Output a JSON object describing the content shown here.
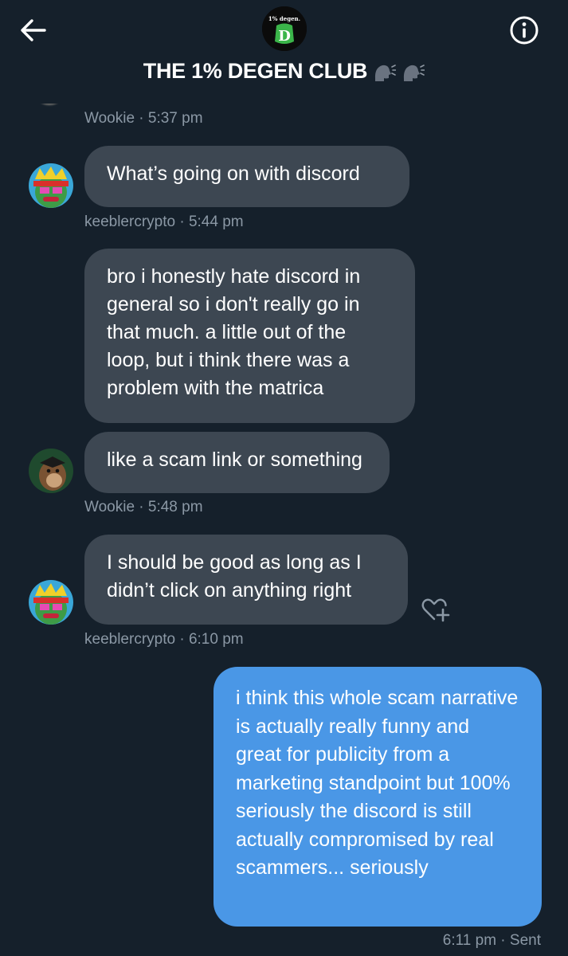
{
  "header": {
    "title": "THE 1% DEGEN CLUB",
    "title_emoji_icon": "speaking-head-icon",
    "back_icon": "arrow-left-icon",
    "info_icon": "info-circle-icon",
    "group_avatar": {
      "line1": "1% degen.",
      "letter": "D"
    }
  },
  "messages": [
    {
      "id": "m0",
      "meta": "Wookie · 5:37 pm"
    },
    {
      "id": "m1",
      "text": "What’s going on with discord",
      "meta": "keeblercrypto · 5:44 pm"
    },
    {
      "id": "m2",
      "text": "bro i honestly hate discord in general so i don't really go in that much.  a little out of the loop, but i think there was a problem with the matrica"
    },
    {
      "id": "m3",
      "text": "like a scam link or something",
      "meta": "Wookie · 5:48 pm"
    },
    {
      "id": "m4",
      "text": "I should be good as long as I didn’t click on anything right",
      "meta": "keeblercrypto · 6:10 pm"
    },
    {
      "id": "m5",
      "text": "i think this whole scam narrative is actually really funny and great for publicity from a marketing standpoint but 100% seriously the discord is still actually compromised by real scammers... seriously",
      "meta": "6:11 pm · Sent"
    }
  ],
  "react_icon": "heart-plus-icon",
  "colors": {
    "background": "#15202b",
    "received_bubble": "#3d4752",
    "sent_bubble": "#4a97e6",
    "meta_text": "#8b98a5"
  }
}
